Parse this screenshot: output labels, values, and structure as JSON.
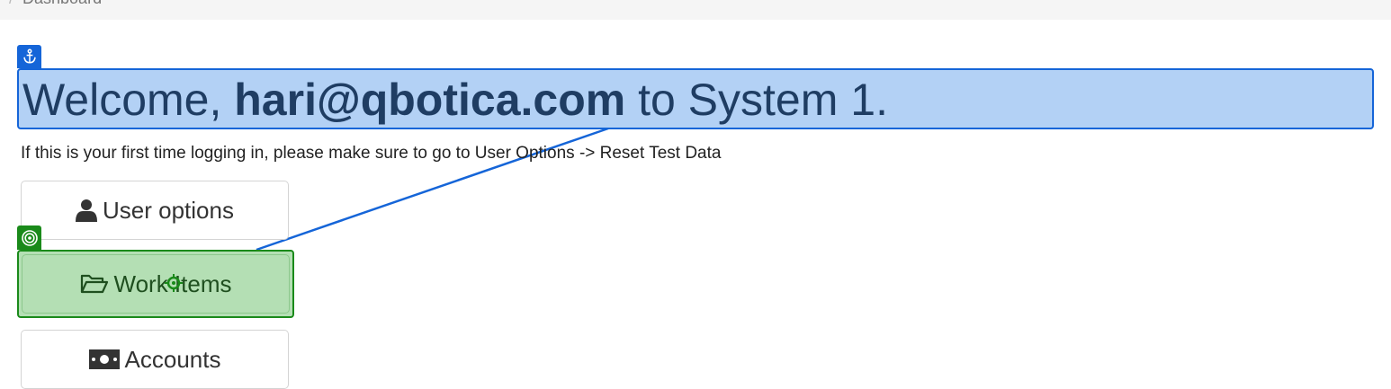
{
  "breadcrumb": {
    "separator": "/",
    "current": "Dashboard"
  },
  "welcome": {
    "prefix": "Welcome, ",
    "user": "hari@qbotica.com",
    "suffix": " to System 1."
  },
  "intro": "If this is your first time logging in, please make sure to go to User Options -> Reset Test Data",
  "menu": {
    "user_options": {
      "label": "User options",
      "icon": "user-icon"
    },
    "work_items": {
      "label": "Work Items",
      "icon": "folder-open-icon"
    },
    "accounts": {
      "label": "Accounts",
      "icon": "money-icon"
    }
  },
  "overlay": {
    "anchor_icon": "anchor-icon",
    "target_icon": "target-icon",
    "anchor_color": "#1565d8",
    "target_color": "#1a8a1a"
  }
}
